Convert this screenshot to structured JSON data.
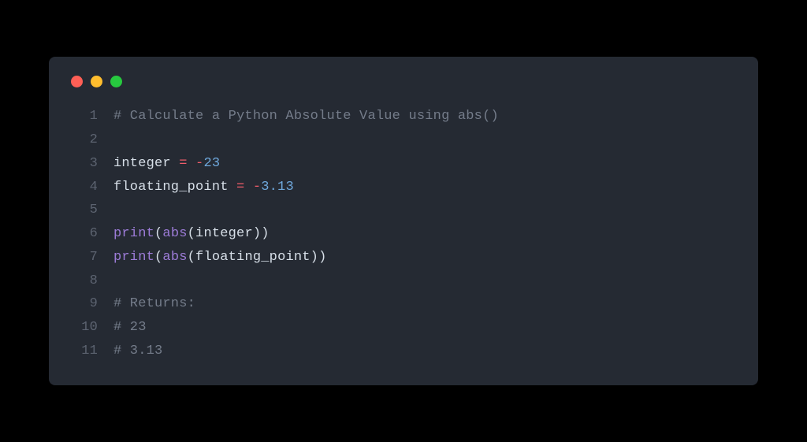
{
  "code": {
    "lines": [
      {
        "n": "1",
        "tokens": [
          {
            "cls": "tok-comment",
            "t": "# Calculate a Python Absolute Value using abs()"
          }
        ]
      },
      {
        "n": "2",
        "tokens": []
      },
      {
        "n": "3",
        "tokens": [
          {
            "cls": "tok-default",
            "t": "integer "
          },
          {
            "cls": "tok-operator",
            "t": "="
          },
          {
            "cls": "tok-default",
            "t": " "
          },
          {
            "cls": "tok-operator",
            "t": "-"
          },
          {
            "cls": "tok-number",
            "t": "23"
          }
        ]
      },
      {
        "n": "4",
        "tokens": [
          {
            "cls": "tok-default",
            "t": "floating_point "
          },
          {
            "cls": "tok-operator",
            "t": "="
          },
          {
            "cls": "tok-default",
            "t": " "
          },
          {
            "cls": "tok-operator",
            "t": "-"
          },
          {
            "cls": "tok-number",
            "t": "3.13"
          }
        ]
      },
      {
        "n": "5",
        "tokens": []
      },
      {
        "n": "6",
        "tokens": [
          {
            "cls": "tok-func",
            "t": "print"
          },
          {
            "cls": "tok-paren",
            "t": "("
          },
          {
            "cls": "tok-func",
            "t": "abs"
          },
          {
            "cls": "tok-paren",
            "t": "("
          },
          {
            "cls": "tok-default",
            "t": "integer"
          },
          {
            "cls": "tok-paren",
            "t": "))"
          }
        ]
      },
      {
        "n": "7",
        "tokens": [
          {
            "cls": "tok-func",
            "t": "print"
          },
          {
            "cls": "tok-paren",
            "t": "("
          },
          {
            "cls": "tok-func",
            "t": "abs"
          },
          {
            "cls": "tok-paren",
            "t": "("
          },
          {
            "cls": "tok-default",
            "t": "floating_point"
          },
          {
            "cls": "tok-paren",
            "t": "))"
          }
        ]
      },
      {
        "n": "8",
        "tokens": []
      },
      {
        "n": "9",
        "tokens": [
          {
            "cls": "tok-comment",
            "t": "# Returns:"
          }
        ]
      },
      {
        "n": "10",
        "tokens": [
          {
            "cls": "tok-comment",
            "t": "# 23"
          }
        ]
      },
      {
        "n": "11",
        "tokens": [
          {
            "cls": "tok-comment",
            "t": "# 3.13"
          }
        ]
      }
    ]
  }
}
